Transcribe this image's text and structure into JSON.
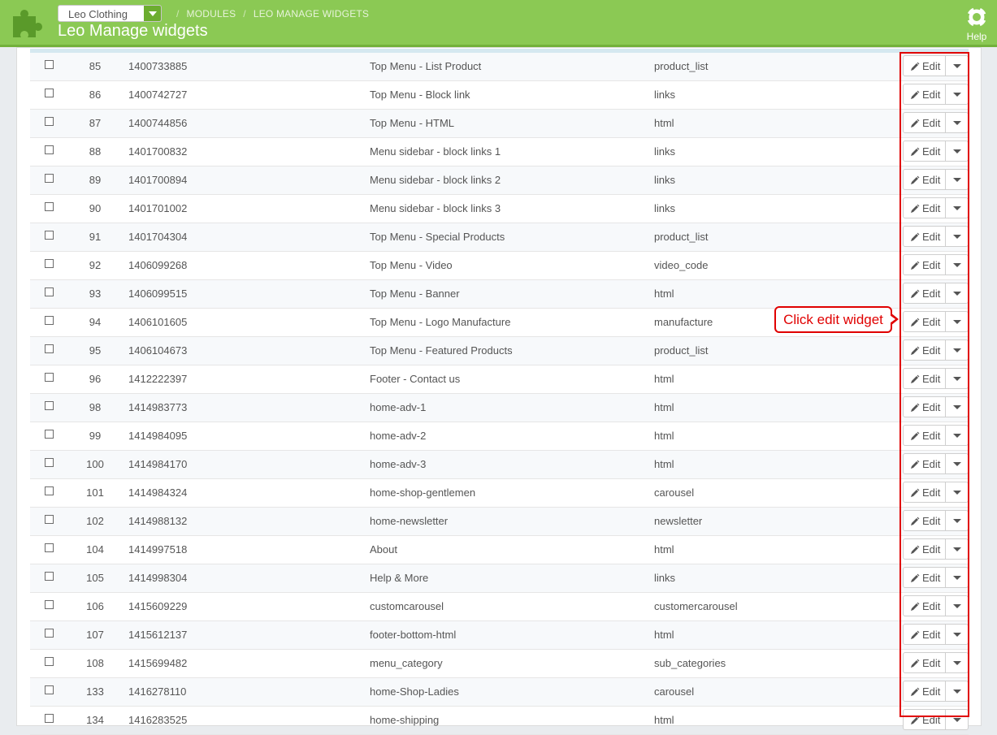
{
  "header": {
    "shop_select": "Leo Clothing",
    "breadcrumb": [
      "MODULES",
      "LEO MANAGE WIDGETS"
    ],
    "title": "Leo Manage widgets",
    "help_label": "Help",
    "colors": {
      "bar": "#8bc954",
      "accent": "#6cad2f"
    }
  },
  "table": {
    "edit_label": "Edit",
    "rows": [
      {
        "id": "85",
        "key": "1400733885",
        "name": "Top Menu - List Product",
        "type": "product_list"
      },
      {
        "id": "86",
        "key": "1400742727",
        "name": "Top Menu - Block link",
        "type": "links"
      },
      {
        "id": "87",
        "key": "1400744856",
        "name": "Top Menu - HTML",
        "type": "html"
      },
      {
        "id": "88",
        "key": "1401700832",
        "name": "Menu sidebar - block links 1",
        "type": "links"
      },
      {
        "id": "89",
        "key": "1401700894",
        "name": "Menu sidebar - block links 2",
        "type": "links"
      },
      {
        "id": "90",
        "key": "1401701002",
        "name": "Menu sidebar - block links 3",
        "type": "links"
      },
      {
        "id": "91",
        "key": "1401704304",
        "name": "Top Menu - Special Products",
        "type": "product_list"
      },
      {
        "id": "92",
        "key": "1406099268",
        "name": "Top Menu - Video",
        "type": "video_code"
      },
      {
        "id": "93",
        "key": "1406099515",
        "name": "Top Menu - Banner",
        "type": "html"
      },
      {
        "id": "94",
        "key": "1406101605",
        "name": "Top Menu - Logo Manufacture",
        "type": "manufacture"
      },
      {
        "id": "95",
        "key": "1406104673",
        "name": "Top Menu - Featured Products",
        "type": "product_list"
      },
      {
        "id": "96",
        "key": "1412222397",
        "name": "Footer - Contact us",
        "type": "html"
      },
      {
        "id": "98",
        "key": "1414983773",
        "name": "home-adv-1",
        "type": "html"
      },
      {
        "id": "99",
        "key": "1414984095",
        "name": "home-adv-2",
        "type": "html"
      },
      {
        "id": "100",
        "key": "1414984170",
        "name": "home-adv-3",
        "type": "html"
      },
      {
        "id": "101",
        "key": "1414984324",
        "name": "home-shop-gentlemen",
        "type": "carousel"
      },
      {
        "id": "102",
        "key": "1414988132",
        "name": "home-newsletter",
        "type": "newsletter"
      },
      {
        "id": "104",
        "key": "1414997518",
        "name": "About",
        "type": "html"
      },
      {
        "id": "105",
        "key": "1414998304",
        "name": "Help & More",
        "type": "links"
      },
      {
        "id": "106",
        "key": "1415609229",
        "name": "customcarousel",
        "type": "customercarousel"
      },
      {
        "id": "107",
        "key": "1415612137",
        "name": "footer-bottom-html",
        "type": "html"
      },
      {
        "id": "108",
        "key": "1415699482",
        "name": "menu_category",
        "type": "sub_categories"
      },
      {
        "id": "133",
        "key": "1416278110",
        "name": "home-Shop-Ladies",
        "type": "carousel"
      },
      {
        "id": "134",
        "key": "1416283525",
        "name": "home-shipping",
        "type": "html"
      }
    ]
  },
  "annotation": {
    "callout_text": "Click edit widget",
    "color": "#e00000"
  }
}
